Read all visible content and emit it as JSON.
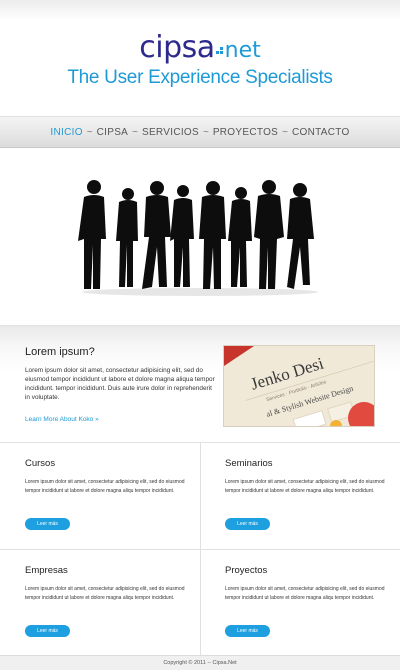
{
  "brand": {
    "logo_main": "cipsa",
    "logo_net": "net",
    "tagline": "The User Experience Specialists",
    "primary_color": "#2d2a8c",
    "accent_color": "#1e9ad6"
  },
  "nav": {
    "items": [
      {
        "label": "INICIO",
        "active": true
      },
      {
        "label": "CIPSA"
      },
      {
        "label": "SERVICIOS"
      },
      {
        "label": "PROYECTOS"
      },
      {
        "label": "CONTACTO"
      }
    ],
    "separator": "~"
  },
  "hero": {
    "image": "silhouettes-of-business-people"
  },
  "feature": {
    "title": "Lorem ipsum?",
    "text": "Lorem ipsum dolor sit amet, consectetur adipisicing elit, sed do eiusmod tempor incididunt ut labore et dolore magna aliqua tempor incididunt. tempor incididunt. Duis aute irure dolor in reprehenderit in voluptate.",
    "link": "Learn More About Koko »",
    "thumb": {
      "title": "Jenko Desi",
      "nav": "Services · Portfolio · Articles",
      "subtitle": "al & Stylish Website Design"
    }
  },
  "boxes": [
    {
      "title": "Cursos",
      "text": "Lorem ipsum dolor sit amet, consectetur adipisicing elit, sed do eiusmod tempor incididunt ut labore et dolore magna aliqu tempor incididunt.",
      "button": "Leer más"
    },
    {
      "title": "Seminarios",
      "text": "Lorem ipsum dolor sit amet, consectetur adipisicing elit, sed do eiusmod tempor incididunt ut labore et dolore magna aliqu tempor incididunt.",
      "button": "Leer más"
    },
    {
      "title": "Empresas",
      "text": "Lorem ipsum dolor sit amet, consectetur adipisicing elit, sed do eiusmod tempor incididunt ut labore et dolore magna aliqu tempor incididunt.",
      "button": "Leer más"
    },
    {
      "title": "Proyectos",
      "text": "Lorem ipsum dolor sit amet, consectetur adipisicing elit, sed do eiusmod tempor incididunt ut labore et dolore magna aliqu tempor incididunt.",
      "button": "Leer más"
    }
  ],
  "footer": {
    "text": "Copyright © 2011 -- Cipsa.Net"
  }
}
